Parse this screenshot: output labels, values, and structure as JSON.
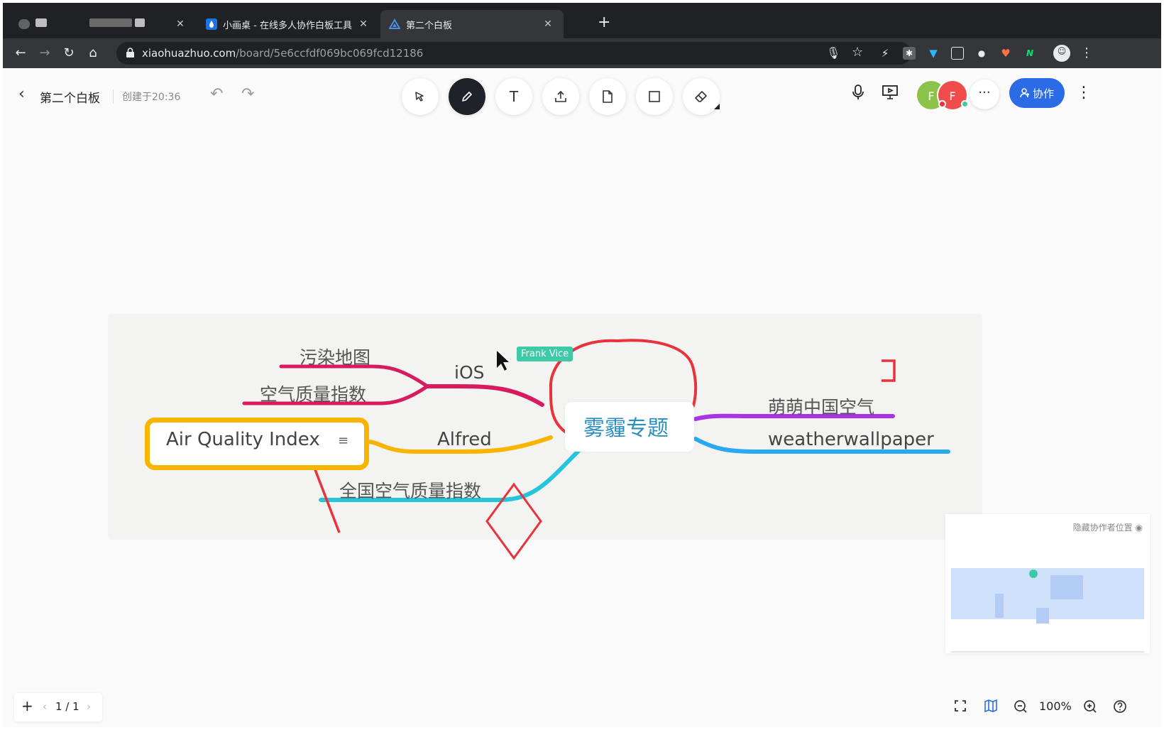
{
  "browser": {
    "tabs": [
      {
        "title": "",
        "favicon": "blurred-icon",
        "active": false
      },
      {
        "title": "小画桌 - 在线多人协作白板工具",
        "favicon": "droplet-icon",
        "active": false
      },
      {
        "title": "第二个白板",
        "favicon": "triangle-icon",
        "active": true
      }
    ],
    "close_glyph": "✕",
    "new_tab_glyph": "+",
    "url_host": "xiaohuazhuo.com",
    "url_path": "/board/5e6ccfdf069bc069fcd12186"
  },
  "header": {
    "back_glyph": "‹",
    "board_title": "第二个白板",
    "created": "创建于20:36",
    "collaborate_label": "协作",
    "more_glyph": "···",
    "menu_glyph": "⋮",
    "avatars": [
      {
        "initial": "F",
        "color": "#8bc34a",
        "status_color": "#e8333c"
      },
      {
        "initial": "F",
        "color": "#f14c4c",
        "status_color": "#3ec9a7"
      }
    ]
  },
  "toolbar": {
    "tools": [
      {
        "name": "select-tool",
        "icon": "cursor-icon",
        "active": false
      },
      {
        "name": "pen-tool",
        "icon": "pencil-icon",
        "active": true
      },
      {
        "name": "text-tool",
        "icon": "text-icon",
        "active": false
      },
      {
        "name": "upload-tool",
        "icon": "upload-icon",
        "active": false
      },
      {
        "name": "note-tool",
        "icon": "file-icon",
        "active": false
      },
      {
        "name": "shape-tool",
        "icon": "square-icon",
        "active": false
      },
      {
        "name": "eraser-tool",
        "icon": "eraser-icon",
        "active": false
      }
    ]
  },
  "mindmap": {
    "root": "雾霾专题",
    "left": {
      "ios": "iOS",
      "ios_children": [
        "污染地图",
        "空气质量指数"
      ],
      "alfred": "Alfred",
      "alfred_child": "Air Quality Index",
      "national": "全国空气质量指数"
    },
    "right": {
      "mengmeng": "萌萌中国空气",
      "weatherwallpaper": "weatherwallpaper"
    },
    "note_glyph": "≡",
    "colors": {
      "ios": "#d81b60",
      "alfred": "#f7b500",
      "national": "#26c6da",
      "mengmeng": "#aa33e6",
      "weatherwallpaper": "#2aa8f2",
      "annotation": "#e8333c"
    }
  },
  "collaborator_cursor": {
    "name": "Frank Vice"
  },
  "minimap": {
    "hide_label": "隐藏协作者位置"
  },
  "pager": {
    "add_glyph": "+",
    "prev_glyph": "‹",
    "next_glyph": "›",
    "page": "1 / 1"
  },
  "zoom": {
    "level": "100%"
  }
}
